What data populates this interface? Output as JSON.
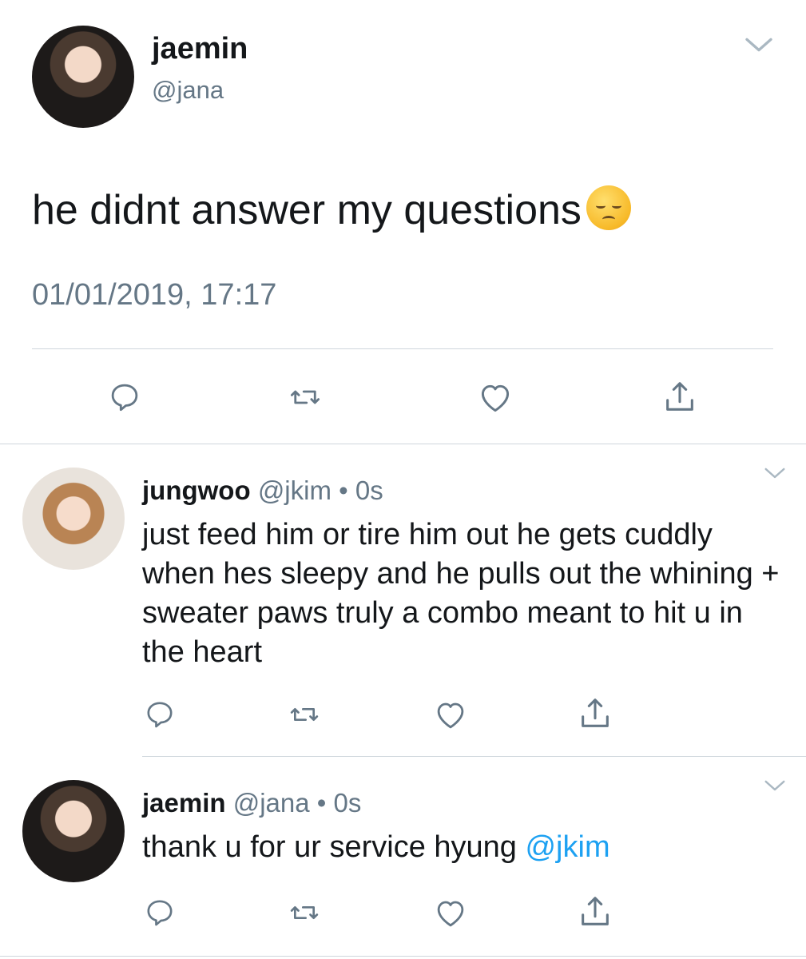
{
  "main_tweet": {
    "display_name": "jaemin",
    "handle": "@jana",
    "text": "he didnt answer my questions",
    "emoji": "pensive-face-emoji",
    "timestamp": "01/01/2019, 17:17"
  },
  "replies": [
    {
      "display_name": "jungwoo",
      "handle": "@jkim",
      "time": "• 0s",
      "text": "just feed him or tire him out he gets cuddly when hes sleepy and he pulls out the whining + sweater paws truly a combo meant to hit u in the heart"
    },
    {
      "display_name": "jaemin",
      "handle": "@jana",
      "time": "• 0s",
      "text": "thank u for ur service hyung",
      "mention": "@jkim"
    }
  ],
  "icons": [
    "chevron-down-icon",
    "reply-icon",
    "retweet-icon",
    "like-icon",
    "share-icon"
  ],
  "colors": {
    "text": "#14171a",
    "secondary": "#657786",
    "mention": "#1da1f2",
    "icon": "#657786"
  }
}
